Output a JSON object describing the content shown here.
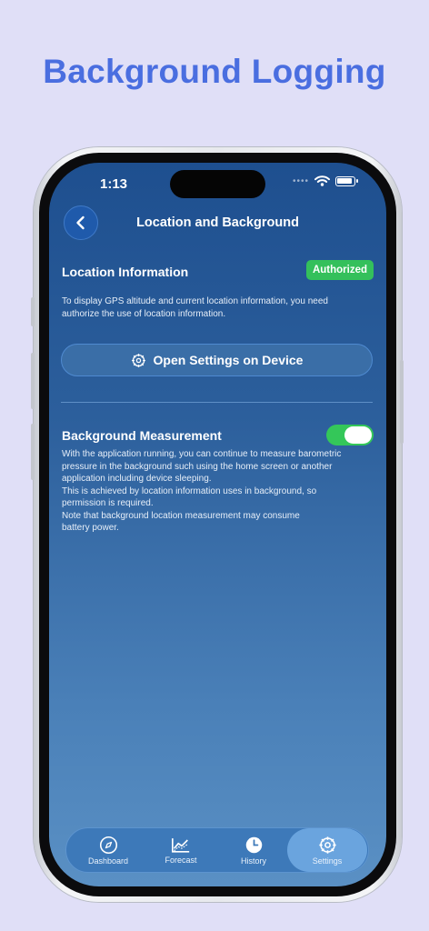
{
  "headline": "Background Logging",
  "status_bar": {
    "time": "1:13",
    "signal_dots": "••••"
  },
  "nav": {
    "title": "Location and Background"
  },
  "location": {
    "title": "Location Information",
    "badge": "Authorized",
    "description_lines": [
      "To display GPS altitude and current location information, you need",
      "authorize the use of location information."
    ],
    "button_label": "Open Settings on Device"
  },
  "background": {
    "title": "Background Measurement",
    "toggle_on": true,
    "description_lines": [
      "With the application running, you can continue to measure barometric",
      "pressure in the background such using the home screen or another",
      "application including device sleeping.",
      "This is achieved by location information uses in background, so",
      "permission is required.",
      "Note that background location measurement may consume",
      "battery power."
    ]
  },
  "tabs": [
    {
      "label": "Dashboard",
      "icon": "compass-icon",
      "active": false
    },
    {
      "label": "Forecast",
      "icon": "chart-icon",
      "active": false
    },
    {
      "label": "History",
      "icon": "clock-icon",
      "active": false
    },
    {
      "label": "Settings",
      "icon": "gear-icon",
      "active": true
    }
  ],
  "colors": {
    "background": "#e0dff7",
    "headline": "#4a6ee0",
    "badge": "#34c05b",
    "toggle": "#34c759",
    "accent": "#1f5aab"
  }
}
